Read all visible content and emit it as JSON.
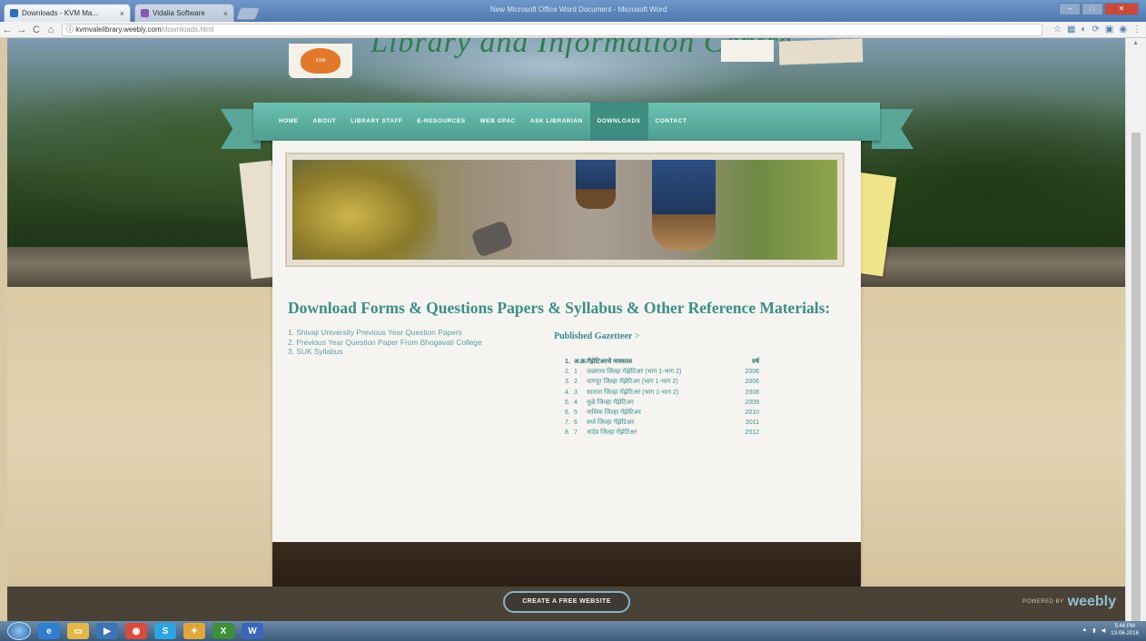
{
  "browser": {
    "tabs": [
      {
        "title": "Downloads - KVM Ma...",
        "close": "×"
      },
      {
        "title": "Vidalia Software",
        "close": "×"
      }
    ],
    "window_title": "New Microsoft Office Word Document - Microsoft Word",
    "window_controls": {
      "min": "–",
      "max": "□",
      "close": "✕"
    },
    "nav": {
      "back": "←",
      "forward": "→",
      "reload": "C",
      "home": "⌂",
      "info": "ⓘ"
    },
    "url": {
      "host": "kvmvalelibrary.weebly.com",
      "path": "/downloads.html"
    },
    "extensions": [
      "☆",
      "▦",
      "◐",
      "⟳",
      "▣",
      "◉",
      "⋮"
    ]
  },
  "site": {
    "title": "Library and Information Centre",
    "logo_text": "KVM",
    "nav_items": [
      {
        "label": "HOME",
        "active": false
      },
      {
        "label": "ABOUT",
        "active": false
      },
      {
        "label": "LIBRARY STAFF",
        "active": false
      },
      {
        "label": "E-RESOURCES",
        "active": false
      },
      {
        "label": "WEB OPAC",
        "active": false
      },
      {
        "label": "ASK LIBRARIAN",
        "active": false
      },
      {
        "label": "DOWNLOADS",
        "active": true
      },
      {
        "label": "CONTACT",
        "active": false
      }
    ]
  },
  "main": {
    "heading": "Download Forms & Questions Papers & Syllabus & Other Reference Materials:",
    "links": [
      "1. Shivaji University Previous Year Question Papers",
      "2. Previous Year Question Paper From Bhogavati College",
      "3. SUK Syllabus"
    ],
    "gazetteer_heading": "Published Gazetteer",
    "gazetteer_arrow": ">",
    "gazetteer_header": {
      "n": "1.",
      "sr": "अ.क्र.",
      "title": "गॅझेटिअरचे नावसाल",
      "year": "वर्ष"
    },
    "gazetteer_rows": [
      {
        "n": "2.",
        "sr": "1",
        "title": "जळगाव जिल्हा गॅझेटिअर (भाग 1-भाग 2)",
        "year": "2006"
      },
      {
        "n": "3.",
        "sr": "2",
        "title": "नागपूर जिल्हा गॅझेटिअर (भाग 1-भाग 2)",
        "year": "2006"
      },
      {
        "n": "4.",
        "sr": "3",
        "title": "सातारा जिल्हा गॅझेटिअर (भाग 1-भाग 2)",
        "year": "2008"
      },
      {
        "n": "5.",
        "sr": "4",
        "title": "धुळे जिल्हा गॅझेटिअर",
        "year": "2009"
      },
      {
        "n": "6.",
        "sr": "5",
        "title": "नाशिक जिल्हा गॅझेटिअर",
        "year": "2010"
      },
      {
        "n": "7.",
        "sr": "6",
        "title": "वर्धा जिल्हा गॅझेटिअर",
        "year": "2011"
      },
      {
        "n": "8.",
        "sr": "7",
        "title": "नांदेड जिल्हा गॅझेटिअर",
        "year": "2012"
      }
    ]
  },
  "footer": {
    "cta": "CREATE A FREE WEBSITE",
    "powered_by": "POWERED BY",
    "brand": "weebly"
  },
  "taskbar": {
    "icons": [
      {
        "name": "ie-icon",
        "glyph": "e",
        "color": "#2f7fd1"
      },
      {
        "name": "folder-icon",
        "glyph": "▭",
        "color": "#e5b749"
      },
      {
        "name": "media-icon",
        "glyph": "▶",
        "color": "#3b75b8"
      },
      {
        "name": "chrome-icon",
        "glyph": "◉",
        "color": "#d94b3a"
      },
      {
        "name": "skype-icon",
        "glyph": "S",
        "color": "#2aa5e1"
      },
      {
        "name": "app-icon",
        "glyph": "✦",
        "color": "#e0a63a"
      },
      {
        "name": "excel-icon",
        "glyph": "X",
        "color": "#3d8f3a"
      },
      {
        "name": "word-icon",
        "glyph": "W",
        "color": "#3a67b8"
      }
    ],
    "time": "5:44 PM",
    "date": "13-06-2016"
  }
}
